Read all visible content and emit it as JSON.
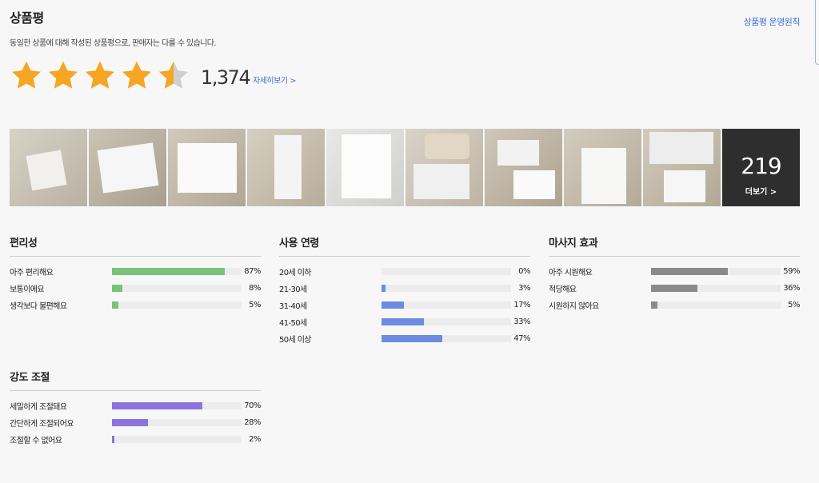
{
  "header": {
    "title": "상품평",
    "policy_link": "상품평 운영원칙",
    "description": "동일한 상품에 대해 작성된 상품평으로, 판매자는 다를 수 있습니다."
  },
  "rating": {
    "stars": 4.5,
    "star_color": "#f5a623",
    "empty_star_color": "#cfcfcf",
    "review_count": "1,374",
    "detail_link": "자세히보기 >"
  },
  "photos": {
    "thumbnail_count_shown": 9,
    "more_count": "219",
    "more_label": "더보기 >"
  },
  "surveys": {
    "convenience": {
      "title": "편리성",
      "color": "#78c27a",
      "rows": [
        {
          "label": "아주 편리해요",
          "percent": "87%",
          "value": 87
        },
        {
          "label": "보통이에요",
          "percent": "8%",
          "value": 8
        },
        {
          "label": "생각보다 불편해요",
          "percent": "5%",
          "value": 5
        }
      ]
    },
    "age": {
      "title": "사용 연령",
      "color": "#6c8ce2",
      "rows": [
        {
          "label": "20세 이하",
          "percent": "0%",
          "value": 0
        },
        {
          "label": "21-30세",
          "percent": "3%",
          "value": 3
        },
        {
          "label": "31-40세",
          "percent": "17%",
          "value": 17
        },
        {
          "label": "41-50세",
          "percent": "33%",
          "value": 33
        },
        {
          "label": "50세 이상",
          "percent": "47%",
          "value": 47
        }
      ]
    },
    "massage": {
      "title": "마사지 효과",
      "color": "#8a8a8a",
      "rows": [
        {
          "label": "아주 시원해요",
          "percent": "59%",
          "value": 59
        },
        {
          "label": "적당해요",
          "percent": "36%",
          "value": 36
        },
        {
          "label": "시원하지 않아요",
          "percent": "5%",
          "value": 5
        }
      ]
    },
    "intensity": {
      "title": "강도 조절",
      "color": "#8b74dc",
      "rows": [
        {
          "label": "세밀하게 조절돼요",
          "percent": "70%",
          "value": 70
        },
        {
          "label": "간단하게 조절되어요",
          "percent": "28%",
          "value": 28
        },
        {
          "label": "조절할 수 없어요",
          "percent": "2%",
          "value": 2
        }
      ]
    }
  }
}
